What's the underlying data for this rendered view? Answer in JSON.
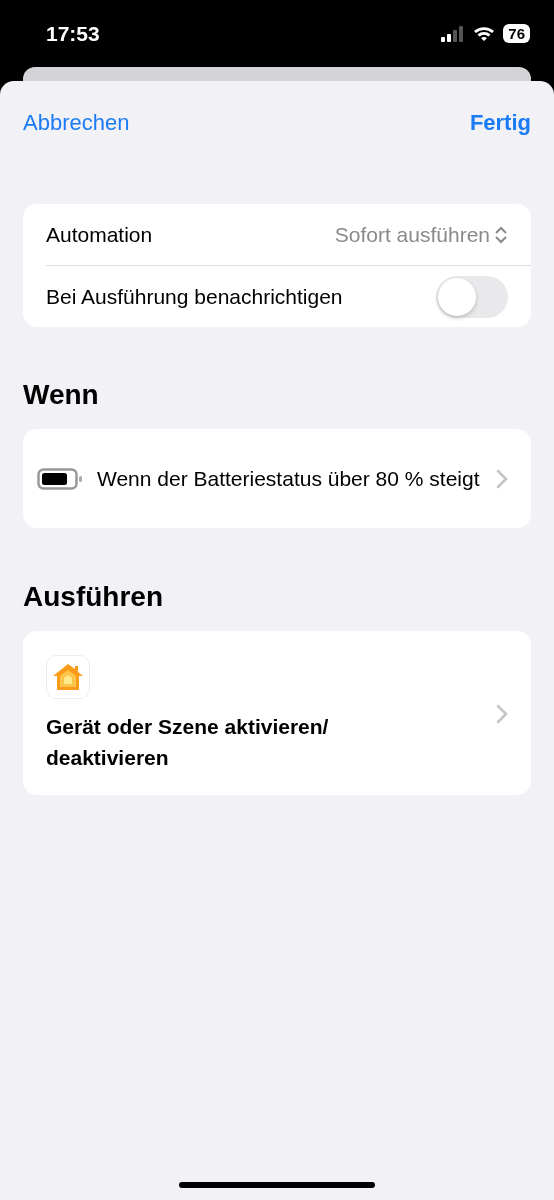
{
  "status_bar": {
    "time": "17:53",
    "battery": "76"
  },
  "nav": {
    "cancel": "Abbrechen",
    "done": "Fertig"
  },
  "settings": [
    {
      "kind": "picker",
      "label": "Automation",
      "value": "Sofort ausführen"
    },
    {
      "kind": "toggle",
      "label": "Bei Ausführung benachrichtigen",
      "on": false
    }
  ],
  "sections": [
    {
      "title": "Wenn",
      "item": {
        "kind": "battery",
        "text": "Wenn der Batteriestatus über 80 % steigt"
      }
    },
    {
      "title": "Ausführen",
      "item": {
        "kind": "home",
        "text": "Gerät oder Szene aktivieren/ deaktivieren"
      }
    }
  ]
}
